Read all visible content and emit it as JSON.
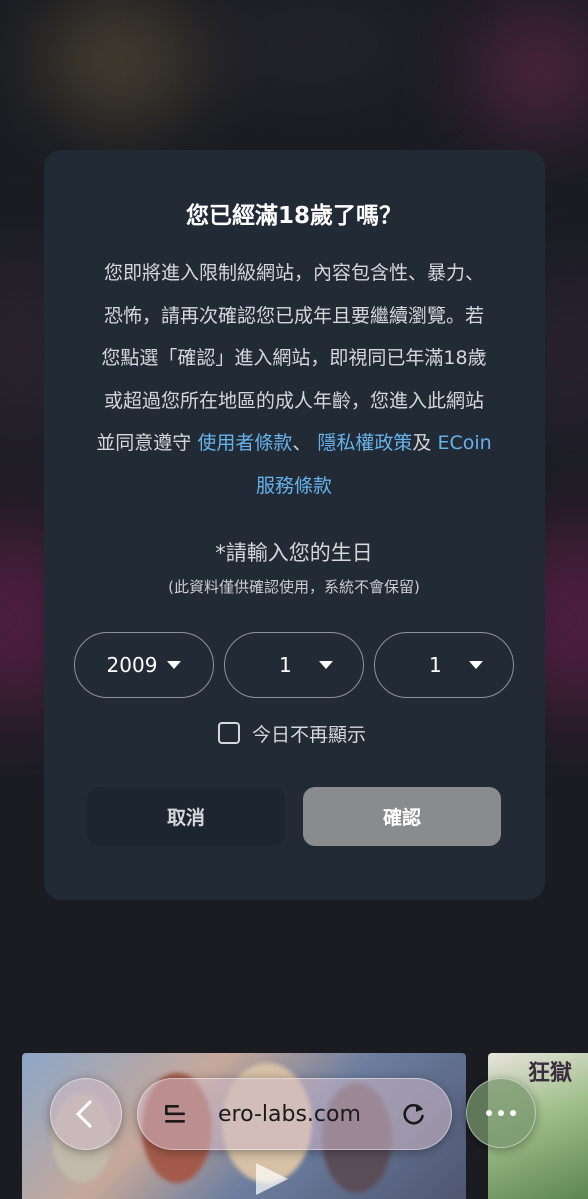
{
  "dialog": {
    "title": "您已經滿18歲了嗎？",
    "lines": [
      "您即將進入限制級網站，內容包含性、暴力、",
      "恐怖，請再次確認您已成年且要繼續瀏覽。若",
      "您點選「確認」進入網站，即視同已年滿18歲",
      "或超過您所在地區的成人年齡，您進入此網站"
    ],
    "agree_prefix": "並同意遵守 ",
    "terms_link": "使用者條款",
    "sep1": "、 ",
    "privacy_link": "隱私權政策",
    "sep2": "及 ",
    "ecoin_link": "ECoin",
    "ecoin_link_line2": "服務條款",
    "birthday_label": "*請輸入您的生日",
    "birthday_note": "(此資料僅供確認使用，系統不會保留)",
    "year": "2009",
    "month": "1",
    "day": "1",
    "dont_show_today": "今日不再顯示",
    "cancel_label": "取消",
    "confirm_label": "確認"
  },
  "banner": {
    "side_text": "狂獄"
  },
  "browser": {
    "url": "ero-labs.com",
    "icons": [
      "back-chevron-icon",
      "reader-icon",
      "reload-icon",
      "more-icon"
    ]
  },
  "colors": {
    "dialog_bg": "#222a35",
    "link": "#66b2ea",
    "confirm_bg": "#8a8b8d",
    "cancel_bg": "#1d2530"
  }
}
